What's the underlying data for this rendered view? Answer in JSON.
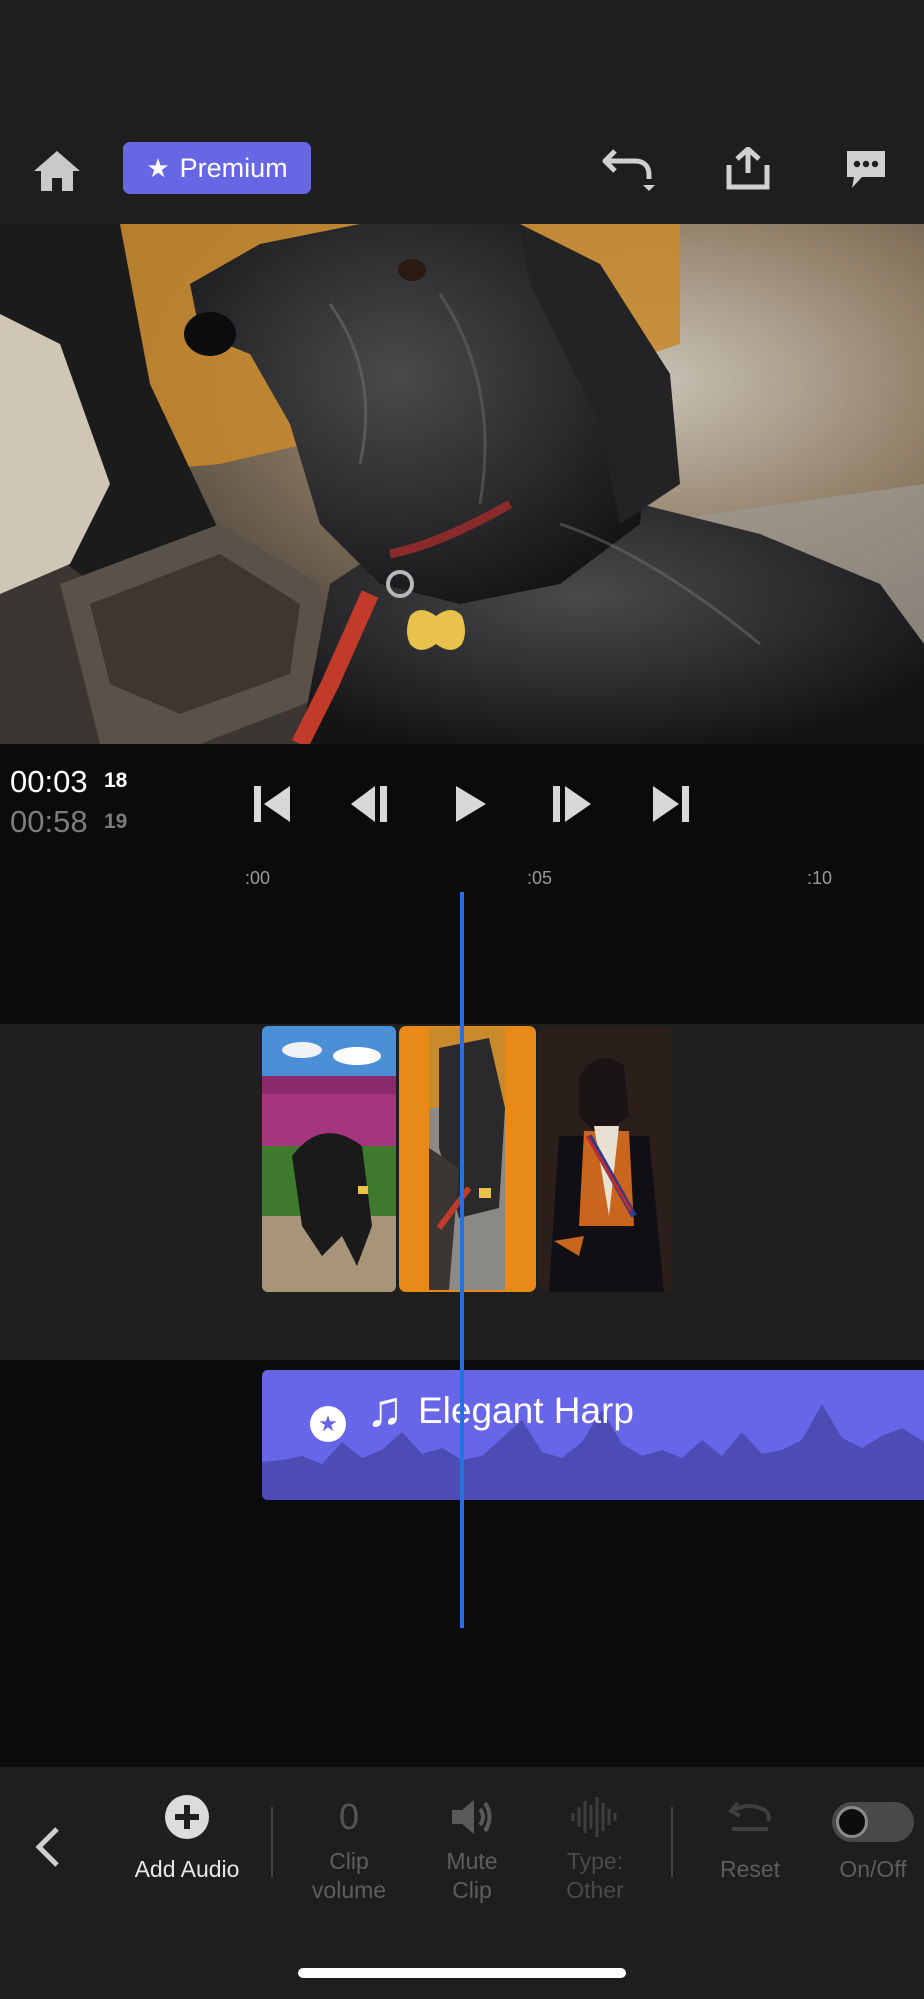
{
  "toolbar": {
    "premium_label": "Premium",
    "home_icon": "home-icon",
    "undo_icon": "undo-icon",
    "share_icon": "share-icon",
    "feedback_icon": "chat-icon"
  },
  "transport": {
    "current_time": "00:03",
    "current_frame": "18",
    "total_time": "00:58",
    "total_frame": "19"
  },
  "timeline": {
    "ruler": [
      ":00",
      ":05",
      ":10"
    ],
    "clips": [
      "tulips-dog-clip",
      "dog-closeup-clip",
      "dog-portrait-clip"
    ],
    "selected_clip_index": 1,
    "audio_title": "Elegant Harp"
  },
  "bottom_bar": {
    "add_audio": "Add Audio",
    "clip_volume_value": "0",
    "clip_volume_line1": "Clip",
    "clip_volume_line2": "volume",
    "mute_line1": "Mute",
    "mute_line2": "Clip",
    "type_line1": "Type:",
    "type_line2": "Other",
    "reset": "Reset",
    "on_off": "On/Off"
  },
  "colors": {
    "accent": "#6767e6",
    "selected_clip": "#e88a18",
    "playhead": "#2a6fe0",
    "panel_bg": "#1e1e1e"
  }
}
